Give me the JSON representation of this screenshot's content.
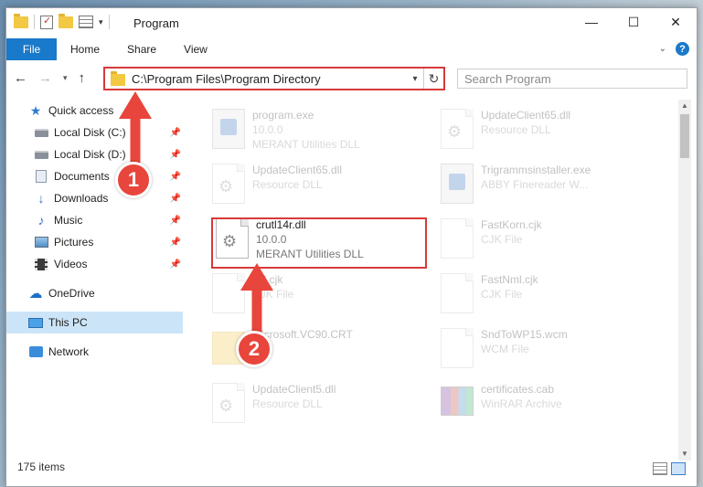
{
  "window": {
    "title": "Program",
    "buttons": {
      "minimize": "—",
      "maximize": "☐",
      "close": "✕"
    }
  },
  "ribbon": {
    "tabs": [
      "File",
      "Home",
      "Share",
      "View"
    ]
  },
  "address": {
    "path": "C:\\Program Files\\Program Directory",
    "search_placeholder": "Search Program"
  },
  "sidebar": {
    "items": [
      {
        "label": "Quick access",
        "icon": "star-icon",
        "pinned": false
      },
      {
        "label": "Local Disk (C:)",
        "icon": "drive-icon",
        "pinned": true
      },
      {
        "label": "Local Disk (D:)",
        "icon": "drive-icon",
        "pinned": true
      },
      {
        "label": "Documents",
        "icon": "documents-icon",
        "pinned": true
      },
      {
        "label": "Downloads",
        "icon": "download-icon",
        "pinned": true
      },
      {
        "label": "Music",
        "icon": "music-icon",
        "pinned": true
      },
      {
        "label": "Pictures",
        "icon": "pictures-icon",
        "pinned": true
      },
      {
        "label": "Videos",
        "icon": "videos-icon",
        "pinned": true
      },
      {
        "label": "OneDrive",
        "icon": "cloud-icon",
        "pinned": false
      },
      {
        "label": "This PC",
        "icon": "pc-icon",
        "pinned": false
      },
      {
        "label": "Network",
        "icon": "network-icon",
        "pinned": false
      }
    ]
  },
  "files": {
    "left": [
      {
        "name": "program.exe",
        "line2": "10.0.0",
        "line3": "MERANT Utilities DLL",
        "faded": true
      },
      {
        "name": "UpdateClient65.dll",
        "line2": "Resource DLL",
        "line3": "",
        "faded": true
      },
      {
        "name": "crutl14r.dll",
        "line2": "10.0.0",
        "line3": "MERANT Utilities DLL",
        "faded": false
      },
      {
        "name": "...ll.cjk",
        "line2": "CJK File",
        "line3": "",
        "faded": true
      },
      {
        "name": "...icrosoft.VC90.CRT",
        "line2": "",
        "line3": "",
        "faded": true
      },
      {
        "name": "UpdateClient5.dll",
        "line2": "Resource DLL",
        "line3": "",
        "faded": true
      }
    ],
    "right": [
      {
        "name": "UpdateClient65.dll",
        "line2": "Resource DLL",
        "faded": true
      },
      {
        "name": "Trigrammsinstaller.exe",
        "line2": "ABBY Finereader W...",
        "faded": true
      },
      {
        "name": "FastKorn.cjk",
        "line2": "CJK File",
        "faded": true
      },
      {
        "name": "FastNml.cjk",
        "line2": "CJK File",
        "faded": true
      },
      {
        "name": "SndToWP15.wcm",
        "line2": "WCM File",
        "faded": true
      },
      {
        "name": "certificates.cab",
        "line2": "WinRAR Archive",
        "faded": true
      }
    ]
  },
  "status": {
    "item_count": "175 items"
  },
  "annotations": {
    "step1": "1",
    "step2": "2"
  },
  "colors": {
    "accent": "#1979ca",
    "highlight": "#d73a3a",
    "badge": "#e8453c",
    "selected": "#cce4f7"
  }
}
